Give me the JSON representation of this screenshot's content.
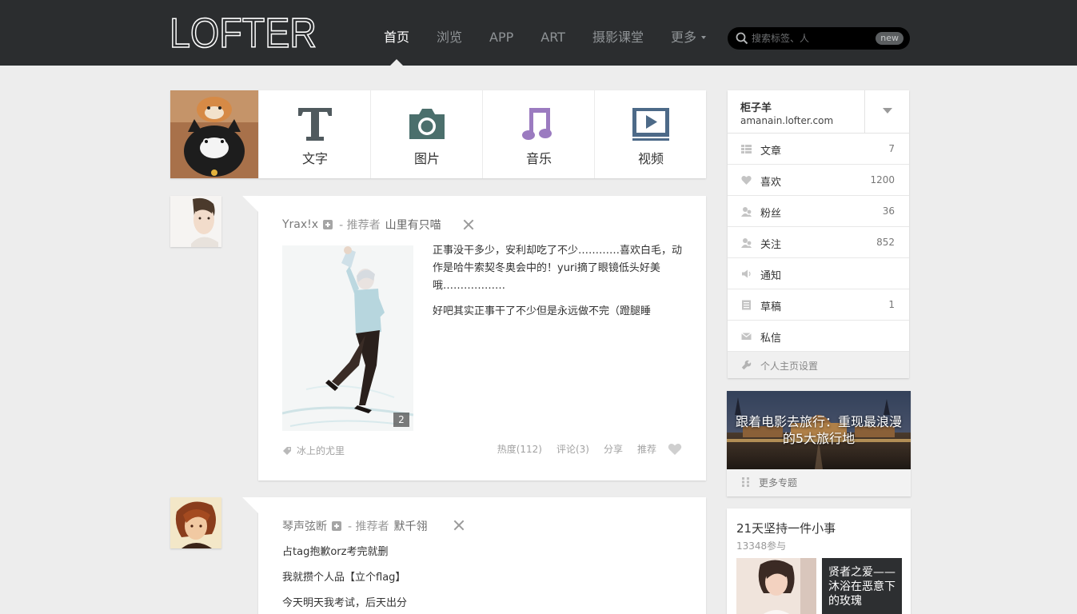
{
  "header": {
    "logo_text": "LOFTER",
    "nav": [
      {
        "label": "首页"
      },
      {
        "label": "浏览"
      },
      {
        "label": "APP"
      },
      {
        "label": "ART"
      },
      {
        "label": "摄影课堂"
      },
      {
        "label": "更多"
      }
    ],
    "search": {
      "placeholder": "搜索标签、人",
      "badge": "new"
    },
    "colors": {
      "topbar": "#2b2d2f",
      "active_nav": "#ffffff",
      "nav": "#8f9396"
    }
  },
  "publish": {
    "text_label": "文字",
    "photo_label": "图片",
    "music_label": "音乐",
    "video_label": "视频",
    "icons": [
      "text-icon",
      "camera-icon",
      "music-note-icon",
      "video-play-icon"
    ],
    "icon_colors": {
      "text": "#505a5e",
      "photo": "#4b6f6c",
      "music": "#9b7bc0",
      "video": "#4d6a88"
    }
  },
  "posts": [
    {
      "author": "Yrax!x",
      "recommend_prefix": "- 推荐者",
      "recommender": "山里有只喵",
      "image_count": "2",
      "paragraphs": [
        "正事没干多少，安利却吃了不少…………喜欢白毛，动作是哈牛索契冬奥会中的！yuri摘了眼镜低头好美哦………………",
        "好吧其实正事干了不少但是永远做不完（蹬腿睡"
      ],
      "tag": "冰上的尤里",
      "hot": "热度(112)",
      "comment": "评论(3)",
      "share": "分享",
      "recommend": "推荐"
    },
    {
      "author": "琴声弦断",
      "recommend_prefix": "- 推荐者",
      "recommender": "默千翎",
      "paragraphs": [
        "占tag抱歉orz考完就删",
        "我就攒个人品【立个flag】",
        "今天明天我考试，后天出分"
      ]
    }
  ],
  "profile": {
    "name": "柜子羊",
    "domain": "amanain.lofter.com",
    "stats": [
      {
        "label": "文章",
        "count": "7",
        "icon": "article-icon"
      },
      {
        "label": "喜欢",
        "count": "1200",
        "icon": "heart-icon"
      },
      {
        "label": "粉丝",
        "count": "36",
        "icon": "followers-icon"
      },
      {
        "label": "关注",
        "count": "852",
        "icon": "following-icon"
      },
      {
        "label": "通知",
        "count": "",
        "icon": "speaker-icon"
      },
      {
        "label": "草稿",
        "count": "1",
        "icon": "draft-icon"
      },
      {
        "label": "私信",
        "count": "",
        "icon": "mail-icon"
      }
    ],
    "settings_label": "个人主页设置"
  },
  "topic": {
    "title": "跟着电影去旅行：重现最浪漫的5大旅行地",
    "more_label": "更多专题"
  },
  "challenge": {
    "title": "21天坚持一件小事",
    "participants": "13348参与",
    "card_title": "贤者之爱——沐浴在恶意下的玫瑰"
  }
}
